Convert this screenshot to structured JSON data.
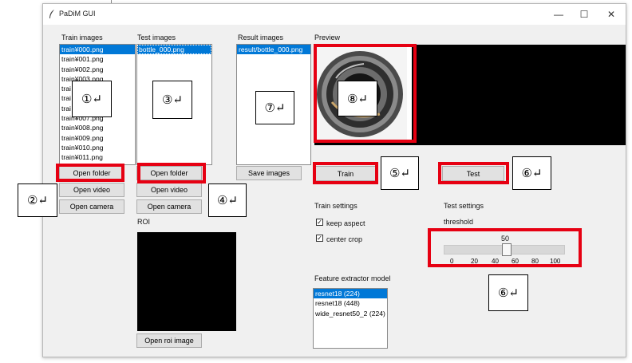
{
  "window": {
    "title": "PaDiM GUI",
    "controls": {
      "minimize": "—",
      "maximize": "☐",
      "close": "✕"
    }
  },
  "train": {
    "label": "Train images",
    "items": [
      "train¥000.png",
      "train¥001.png",
      "train¥002.png",
      "train¥003.png",
      "trai",
      "trai",
      "trai",
      "train¥007.png",
      "train¥008.png",
      "train¥009.png",
      "train¥010.png",
      "train¥011.png"
    ],
    "open_folder": "Open folder",
    "open_video": "Open video",
    "open_camera": "Open camera"
  },
  "test": {
    "label": "Test images",
    "items": [
      "bottle_000.png"
    ],
    "open_folder": "Open folder",
    "open_video": "Open video",
    "open_camera": "Open camera"
  },
  "result": {
    "label": "Result images",
    "items": [
      "result/bottle_000.png"
    ],
    "save": "Save images"
  },
  "preview": {
    "label": "Preview"
  },
  "roi": {
    "label": "ROI",
    "open": "Open roi image"
  },
  "actions": {
    "train": "Train",
    "test": "Test"
  },
  "train_settings": {
    "label": "Train settings",
    "keep_aspect": {
      "label": "keep aspect",
      "checked": true
    },
    "center_crop": {
      "label": "center crop",
      "checked": true
    }
  },
  "test_settings": {
    "label": "Test settings",
    "threshold_label": "threshold",
    "threshold_value": "50",
    "ticks": [
      "0",
      "20",
      "40",
      "60",
      "80",
      "100"
    ]
  },
  "model": {
    "label": "Feature extractor model",
    "items": [
      "resnet18 (224)",
      "resnet18 (448)",
      "wide_resnet50_2 (224)"
    ]
  },
  "annotations": {
    "m1": "①↵",
    "m2": "②↵",
    "m3": "③↵",
    "m4": "④↵",
    "m5": "⑤↵",
    "m6a": "⑥↵",
    "m6b": "⑥↵",
    "m7": "⑦↵",
    "m8": "⑧↵"
  },
  "colors": {
    "highlight": "#e60012",
    "selection": "#0078d7",
    "window_bg": "#f0f0f0"
  }
}
